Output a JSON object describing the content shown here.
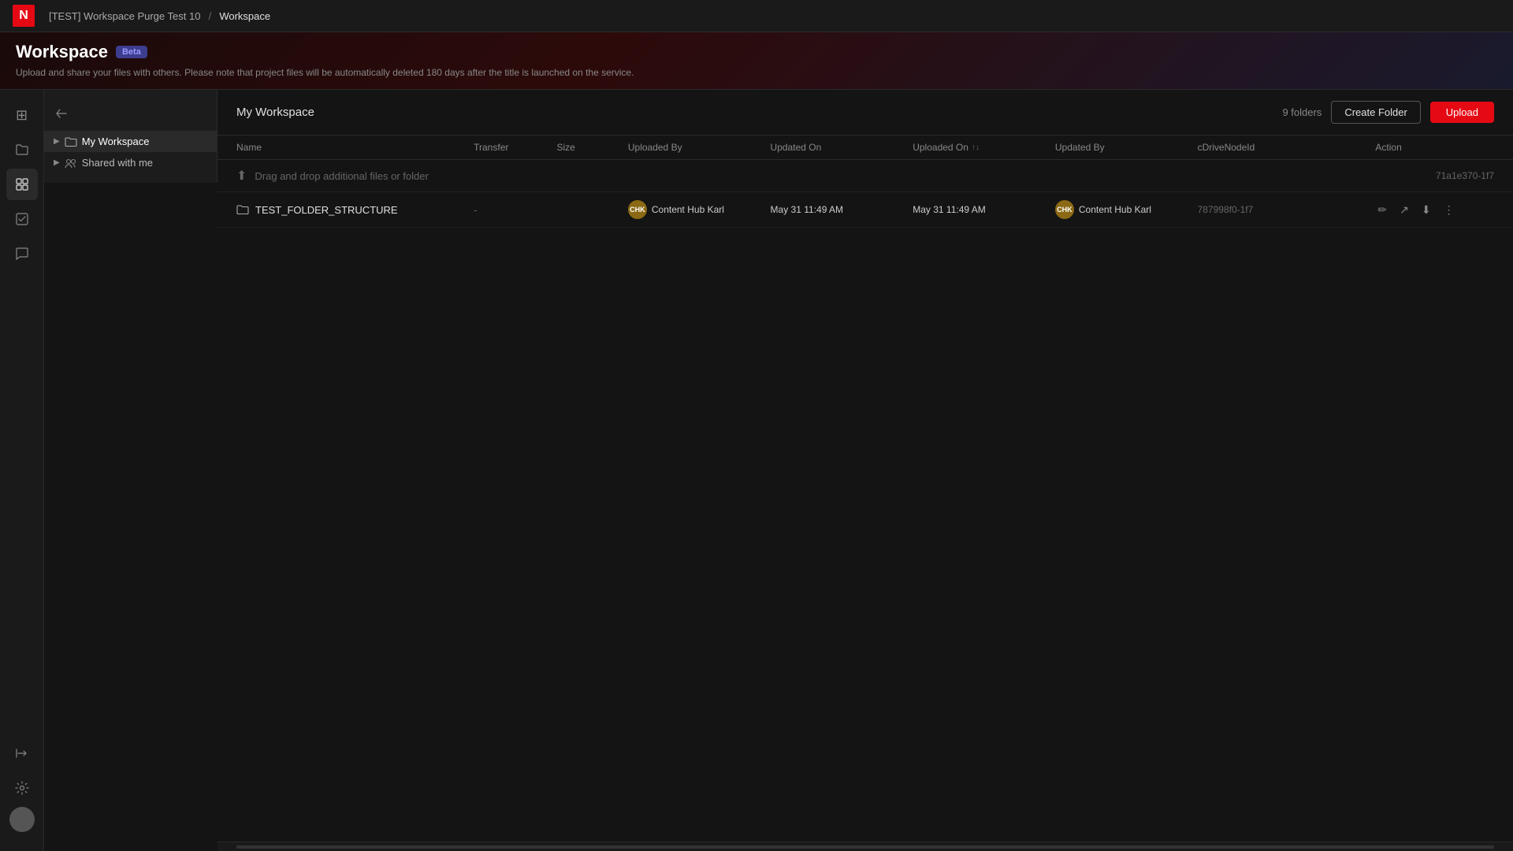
{
  "breadcrumb": {
    "project": "[TEST] Workspace Purge Test 10",
    "section": "Workspace"
  },
  "page": {
    "title": "Workspace",
    "badge": "Beta",
    "subtitle": "Upload and share your files with others. Please note that project files will be automatically deleted 180 days after the title is launched on the service."
  },
  "sidebar_icons": [
    {
      "name": "grid-icon",
      "symbol": "⊞",
      "active": false
    },
    {
      "name": "folder-nav-icon",
      "symbol": "🗂",
      "active": false
    },
    {
      "name": "workspace-icon",
      "symbol": "▣",
      "active": true
    },
    {
      "name": "task-icon",
      "symbol": "☑",
      "active": false
    },
    {
      "name": "chat-icon",
      "symbol": "💬",
      "active": false
    }
  ],
  "file_tree": {
    "my_workspace_label": "My Workspace",
    "shared_label": "Shared with me"
  },
  "workspace": {
    "title": "My Workspace",
    "folders_count": "9 folders",
    "create_folder_label": "Create Folder",
    "upload_label": "Upload"
  },
  "table": {
    "columns": [
      "Name",
      "Transfer",
      "Size",
      "Uploaded By",
      "Updated On",
      "Uploaded On",
      "Updated By",
      "cDriveNodeId",
      "Action"
    ],
    "uploaded_on_sort": "↑↓",
    "drag_drop_text": "Drag and drop additional files or folder",
    "drag_drop_nodeid": "71a1e370-1f7",
    "rows": [
      {
        "name": "TEST_FOLDER_STRUCTURE",
        "type": "folder",
        "transfer": "-",
        "size": "",
        "uploaded_by_avatar": "CHK",
        "uploaded_by_name": "Content Hub Karl",
        "updated_on": "May 31 11:49 AM",
        "uploaded_on": "May 31 11:49 AM",
        "updated_by_avatar": "CHK",
        "updated_by_name": "Content Hub Karl",
        "node_id": "787998f0-1f7"
      }
    ]
  },
  "bottom": {
    "settings_icon": "⚙",
    "collapse_icon": "⊣",
    "expand_icon": "⊢"
  }
}
